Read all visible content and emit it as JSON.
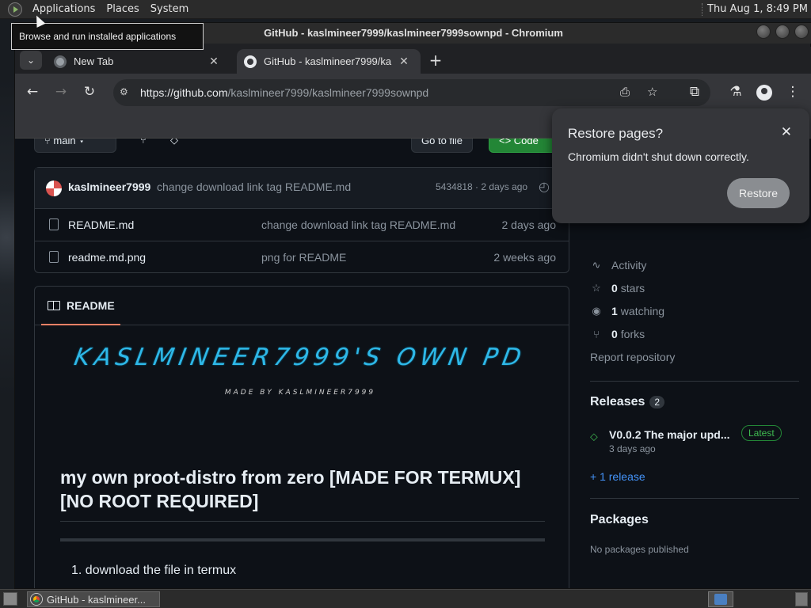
{
  "top_panel": {
    "menus": [
      "Applications",
      "Places",
      "System"
    ],
    "clock": "Thu Aug  1,  8:49 PM"
  },
  "tooltip": "Browse and run installed applications",
  "window": {
    "title": "GitHub - kaslmineer7999/kaslmineer7999sownpd - Chromium"
  },
  "tabs": [
    {
      "label": "New Tab",
      "icon": "globe-icon"
    },
    {
      "label": "GitHub - kaslmineer7999/ka",
      "icon": "github-icon"
    }
  ],
  "toolbar": {
    "url_host": "https://github.com",
    "url_path": "/kaslmineer7999/kaslmineer7999sownpd"
  },
  "repo_buttons": {
    "branch": "main",
    "go_to_file": "Go to file",
    "code": "Code"
  },
  "commit": {
    "author": "kaslmineer7999",
    "message": "change download link tag README.md",
    "sha_time": "5434818 · 2 days ago"
  },
  "files": [
    {
      "name": "README.md",
      "message": "change download link tag README.md",
      "date": "2 days ago"
    },
    {
      "name": "readme.md.png",
      "message": "png for README",
      "date": "2 weeks ago"
    }
  ],
  "readme": {
    "tab_label": "README",
    "banner_title": "KASLMINEER7999'S OWN PD",
    "banner_sub": "MADE BY KASLMINEER7999",
    "heading": "my own proot-distro from zero [MADE FOR TERMUX] [NO ROOT REQUIRED]",
    "list_item_1": "1. download the file in termux"
  },
  "sidebar": {
    "activity": "Activity",
    "stars_count": "0",
    "stars_label": "stars",
    "watching_count": "1",
    "watching_label": "watching",
    "forks_count": "0",
    "forks_label": "forks",
    "report": "Report repository",
    "releases_title": "Releases",
    "releases_count": "2",
    "release_name": "V0.0.2 The major upd...",
    "latest_badge": "Latest",
    "release_date": "3 days ago",
    "more_releases": "+ 1 release",
    "packages_title": "Packages",
    "no_packages": "No packages published"
  },
  "restore_dialog": {
    "title": "Restore pages?",
    "text": "Chromium didn't shut down correctly.",
    "button": "Restore"
  },
  "taskbar": {
    "task_label": "GitHub - kaslmineer..."
  }
}
